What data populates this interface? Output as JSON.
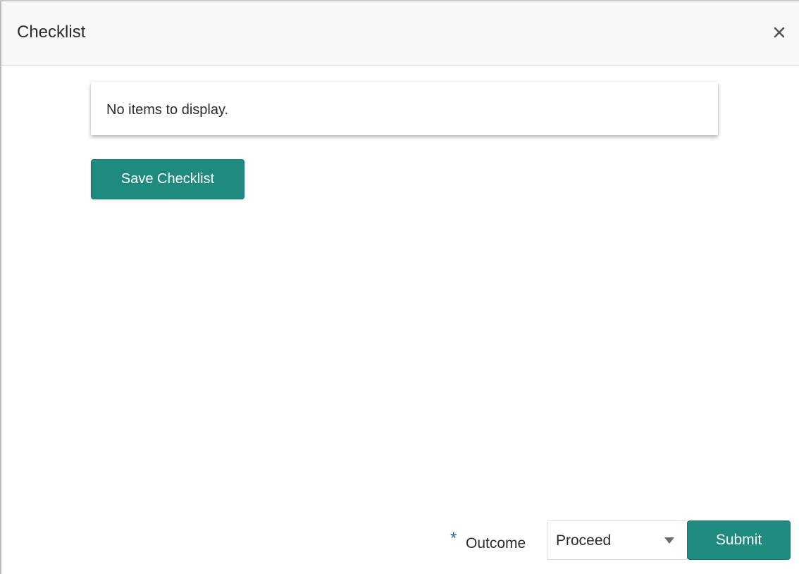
{
  "dialog": {
    "title": "Checklist",
    "close_icon": "close-icon"
  },
  "checklist": {
    "empty_message": "No items to display.",
    "save_label": "Save Checklist"
  },
  "footer": {
    "required_marker": "*",
    "outcome_label": "Outcome",
    "outcome_value": "Proceed",
    "submit_label": "Submit",
    "caret_icon": "caret-down-icon"
  },
  "colors": {
    "accent": "#1f8a80",
    "required": "#1f6fa8",
    "header_bg": "#f8f8f8"
  }
}
